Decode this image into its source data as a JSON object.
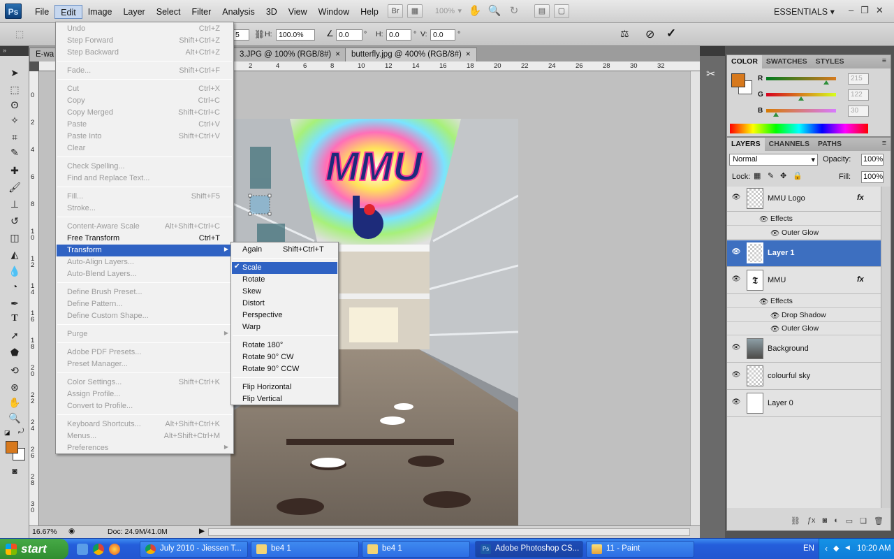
{
  "app": {
    "logo": "Ps",
    "menus": [
      "File",
      "Edit",
      "Image",
      "Layer",
      "Select",
      "Filter",
      "Analysis",
      "3D",
      "View",
      "Window",
      "Help"
    ],
    "active_menu": "Edit",
    "zoom_dropdown": "100%",
    "workspace": "ESSENTIALS",
    "toolbar_buttons": [
      "Br",
      "Mb",
      "hand",
      "zoom",
      "rotate",
      "arrange",
      "screen"
    ]
  },
  "options": {
    "x_value": "5",
    "h_label": "H:",
    "w_value": "100.0%",
    "angle_value": "0.0",
    "deg": "°",
    "hskew_label": "H:",
    "hskew_value": "0.0",
    "vskew_label": "V:",
    "vskew_value": "0.0"
  },
  "tabs": [
    {
      "label": "E-wa",
      "close": ""
    },
    {
      "label": "3.JPG @ 100% (RGB/8#)",
      "close": "×"
    },
    {
      "label": "butterfly.jpg @ 400% (RGB/8#)",
      "close": "×"
    }
  ],
  "ruler": {
    "top": [
      "2",
      "4",
      "6",
      "8",
      "10",
      "12",
      "14",
      "16",
      "18",
      "20",
      "22",
      "24",
      "26",
      "28",
      "30",
      "32"
    ],
    "left": [
      "0",
      "2",
      "4",
      "6",
      "8",
      "1 0",
      "1 2",
      "1 4",
      "1 6",
      "1 8",
      "2 0",
      "2 2",
      "2 4",
      "2 6",
      "2 8",
      "3 0"
    ]
  },
  "status": {
    "zoom": "16.67%",
    "doc": "Doc: 24.9M/41.0M"
  },
  "edit_menu": [
    {
      "label": "Undo",
      "shortcut": "Ctrl+Z",
      "disabled": true
    },
    {
      "label": "Step Forward",
      "shortcut": "Shift+Ctrl+Z",
      "disabled": true
    },
    {
      "label": "Step Backward",
      "shortcut": "Alt+Ctrl+Z",
      "disabled": true
    },
    {
      "label": "Fade...",
      "shortcut": "Shift+Ctrl+F",
      "disabled": true
    },
    {
      "label": "Cut",
      "shortcut": "Ctrl+X",
      "disabled": true
    },
    {
      "label": "Copy",
      "shortcut": "Ctrl+C",
      "disabled": true
    },
    {
      "label": "Copy Merged",
      "shortcut": "Shift+Ctrl+C",
      "disabled": true
    },
    {
      "label": "Paste",
      "shortcut": "Ctrl+V",
      "disabled": true
    },
    {
      "label": "Paste Into",
      "shortcut": "Shift+Ctrl+V",
      "disabled": true
    },
    {
      "label": "Clear",
      "shortcut": "",
      "disabled": true
    },
    {
      "label": "Check Spelling...",
      "shortcut": "",
      "disabled": true
    },
    {
      "label": "Find and Replace Text...",
      "shortcut": "",
      "disabled": true
    },
    {
      "label": "Fill...",
      "shortcut": "Shift+F5",
      "disabled": true
    },
    {
      "label": "Stroke...",
      "shortcut": "",
      "disabled": true
    },
    {
      "label": "Content-Aware Scale",
      "shortcut": "Alt+Shift+Ctrl+C",
      "disabled": true
    },
    {
      "label": "Free Transform",
      "shortcut": "Ctrl+T",
      "disabled": false
    },
    {
      "label": "Transform",
      "shortcut": "",
      "disabled": false,
      "highlight": true,
      "submenu": true
    },
    {
      "label": "Auto-Align Layers...",
      "shortcut": "",
      "disabled": true
    },
    {
      "label": "Auto-Blend Layers...",
      "shortcut": "",
      "disabled": true
    },
    {
      "label": "Define Brush Preset...",
      "shortcut": "",
      "disabled": true
    },
    {
      "label": "Define Pattern...",
      "shortcut": "",
      "disabled": true
    },
    {
      "label": "Define Custom Shape...",
      "shortcut": "",
      "disabled": true
    },
    {
      "label": "Purge",
      "shortcut": "",
      "disabled": true,
      "submenu": true
    },
    {
      "label": "Adobe PDF Presets...",
      "shortcut": "",
      "disabled": true
    },
    {
      "label": "Preset Manager...",
      "shortcut": "",
      "disabled": true
    },
    {
      "label": "Color Settings...",
      "shortcut": "Shift+Ctrl+K",
      "disabled": true
    },
    {
      "label": "Assign Profile...",
      "shortcut": "",
      "disabled": true
    },
    {
      "label": "Convert to Profile...",
      "shortcut": "",
      "disabled": true
    },
    {
      "label": "Keyboard Shortcuts...",
      "shortcut": "Alt+Shift+Ctrl+K",
      "disabled": true
    },
    {
      "label": "Menus...",
      "shortcut": "Alt+Shift+Ctrl+M",
      "disabled": true
    },
    {
      "label": "Preferences",
      "shortcut": "",
      "disabled": true,
      "submenu": true
    }
  ],
  "transform_menu": [
    {
      "label": "Again",
      "shortcut": "Shift+Ctrl+T"
    },
    {
      "label": "Scale",
      "shortcut": "",
      "checked": true,
      "highlight": true
    },
    {
      "label": "Rotate",
      "shortcut": ""
    },
    {
      "label": "Skew",
      "shortcut": ""
    },
    {
      "label": "Distort",
      "shortcut": ""
    },
    {
      "label": "Perspective",
      "shortcut": ""
    },
    {
      "label": "Warp",
      "shortcut": ""
    },
    {
      "label": "Rotate 180°",
      "shortcut": ""
    },
    {
      "label": "Rotate 90° CW",
      "shortcut": ""
    },
    {
      "label": "Rotate 90° CCW",
      "shortcut": ""
    },
    {
      "label": "Flip Horizontal",
      "shortcut": ""
    },
    {
      "label": "Flip Vertical",
      "shortcut": ""
    }
  ],
  "color_panel": {
    "tabs": [
      "COLOR",
      "SWATCHES",
      "STYLES"
    ],
    "r": {
      "label": "R",
      "value": "215"
    },
    "g": {
      "label": "G",
      "value": "122"
    },
    "b": {
      "label": "B",
      "value": "30"
    },
    "foreground": "#d7791d",
    "background": "#ffffff"
  },
  "layers_panel": {
    "tabs": [
      "LAYERS",
      "CHANNELS",
      "PATHS"
    ],
    "blend_mode": "Normal",
    "opacity_label": "Opacity:",
    "opacity": "100%",
    "lock_label": "Lock:",
    "fill_label": "Fill:",
    "fill": "100%",
    "fx": "fx",
    "effects_label": "Effects",
    "layers": [
      {
        "name": "MMU Logo",
        "fx": true,
        "effects": [
          "Outer Glow"
        ]
      },
      {
        "name": "Layer 1",
        "selected": true
      },
      {
        "name": "MMU",
        "fx": true,
        "effects": [
          "Drop Shadow",
          "Outer Glow"
        ]
      },
      {
        "name": "Background"
      },
      {
        "name": "colourful sky"
      },
      {
        "name": "Layer 0"
      }
    ]
  },
  "artwork": {
    "logo_text": "MMU"
  },
  "taskbar": {
    "start": "start",
    "tasks": [
      {
        "label": "July 2010 - Jiessen T..."
      },
      {
        "label": "be4 1"
      },
      {
        "label": "be4 1"
      },
      {
        "label": "Adobe Photoshop CS...",
        "active": true
      },
      {
        "label": "11 - Paint"
      }
    ],
    "lang": "EN",
    "clock": "10:20 AM"
  }
}
